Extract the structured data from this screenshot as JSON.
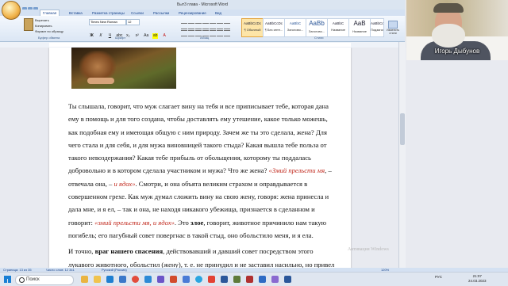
{
  "window": {
    "title": "Быт3 глава - Microsoft Word"
  },
  "ribbon_tabs": [
    "Главная",
    "Вставка",
    "Разметка страницы",
    "Ссылки",
    "Рассылки",
    "Рецензирование",
    "Вид"
  ],
  "clipboard": {
    "cut": "Вырезать",
    "copy": "Копировать",
    "format_painter": "Формат по образцу",
    "group_label": "Буфер обмена"
  },
  "font": {
    "family": "Times New Roman",
    "size": "12",
    "group_label": "Шрифт"
  },
  "paragraph": {
    "group_label": "Абзац"
  },
  "styles": {
    "items": [
      {
        "sample": "AaBbCcDc",
        "name": "¶ Обычный",
        "selected": true
      },
      {
        "sample": "AaBbCcDc",
        "name": "¶ Без инте..."
      },
      {
        "sample": "AaBbC",
        "name": "Заголово..."
      },
      {
        "sample": "AaBb",
        "name": "Заголово...",
        "big": true
      },
      {
        "sample": "AaBbC",
        "name": "Название"
      },
      {
        "sample": "AaBbCcI",
        "name": "Подзагол..."
      },
      {
        "sample": "AaBbCcDc",
        "name": "Слабое в..."
      },
      {
        "sample": "AaBbCcDc",
        "name": "Выделение"
      },
      {
        "sample": "AaB",
        "name": "Название",
        "big": true
      },
      {
        "sample": "AaBbCcDc",
        "name": "Подзагол..."
      },
      {
        "sample": "AaBbCcDc",
        "name": "Сильное в..."
      }
    ],
    "change_styles": "Изменить стили",
    "group_label": "Стили"
  },
  "webcam": {
    "name": "Игорь Дыбунов"
  },
  "document": {
    "p1": {
      "a": "Ты слышала, говорит, что муж слагает вину на тебя и все приписывает тебе, которая дана ему в помощь и для того создана, чтобы доставлять ему утешение, какое только можешь, как подобная ему и имеющая общую с ним природу. Зачем же ты это сделала, жена? Для чего стала и для себя, и для мужа виновницей такого стыда? Какая вышла тебе польза от такого невоздержания? Какая тебе прибыль от обольщения, которому ты поддалась добровольно и в котором сделала участником и мужа? Что же жена? ",
      "quote1": "«Змий прельсти мя",
      "b": ", – отвечала она, – ",
      "quote2": "и ядох»",
      "c": ". Смотри, и она объята великим страхом и оправдывается в совершенном грехе. Как муж думал сложить вину на свою жену, говоря: жена принесла и дала мне, и я ел, – так и она, не находя никакого убежища, признается в сделанном и говорит: ",
      "quote3": "«змий прельсти мя, и ядох»",
      "d": ". Это ",
      "bold1": "злое",
      "e": ", говорит, животное причинило нам такую погибель; его пагубный совет повергнас в такой стыд, оно обольстило меня, и я ела."
    },
    "p2": {
      "a": "И точно, ",
      "bold": "враг нашего спасения",
      "b": ", действовавший и давший совет посредством этого лукавого животного, обольстил (жену), т. е. не принудил и не заставил насильно, но привел в дело"
    }
  },
  "status_bar": {
    "page": "Страница: 13 из 35",
    "words": "Число слов: 12 341",
    "language": "Русский (Россия)",
    "zoom": "120%"
  },
  "watermark": "Активация Windows",
  "taskbar": {
    "search_placeholder": "Поиск",
    "language": "РУС",
    "time": "21:07",
    "date": "24.03.2023"
  }
}
